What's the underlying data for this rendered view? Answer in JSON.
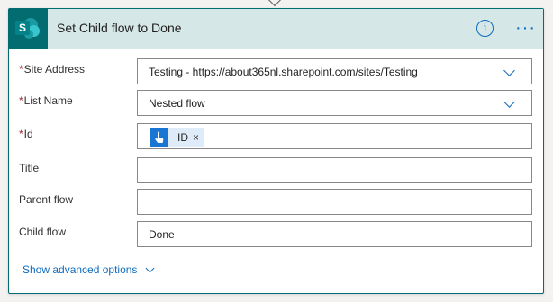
{
  "action": {
    "title": "Set Child flow to Done",
    "info_glyph": "i",
    "more_glyph": "···"
  },
  "fields": {
    "site_address": {
      "label": "Site Address",
      "required": "*",
      "value": "Testing - https://about365nl.sharepoint.com/sites/Testing"
    },
    "list_name": {
      "label": "List Name",
      "required": "*",
      "value": "Nested flow"
    },
    "id": {
      "label": "Id",
      "required": "*",
      "token_label": "ID",
      "token_remove": "×"
    },
    "title": {
      "label": "Title",
      "value": ""
    },
    "parent_flow": {
      "label": "Parent flow",
      "value": ""
    },
    "child_flow": {
      "label": "Child flow",
      "value": "Done"
    }
  },
  "advanced": {
    "label": "Show advanced options"
  },
  "icons": {
    "connector": "sharepoint-icon",
    "token": "manual-trigger-icon"
  },
  "colors": {
    "header_bg": "#d5e7e7",
    "brand": "#036c70",
    "accent": "#0f6cbd",
    "required": "#a4262c",
    "token_bg": "#deecf9",
    "token_icon_bg": "#1976d2"
  }
}
